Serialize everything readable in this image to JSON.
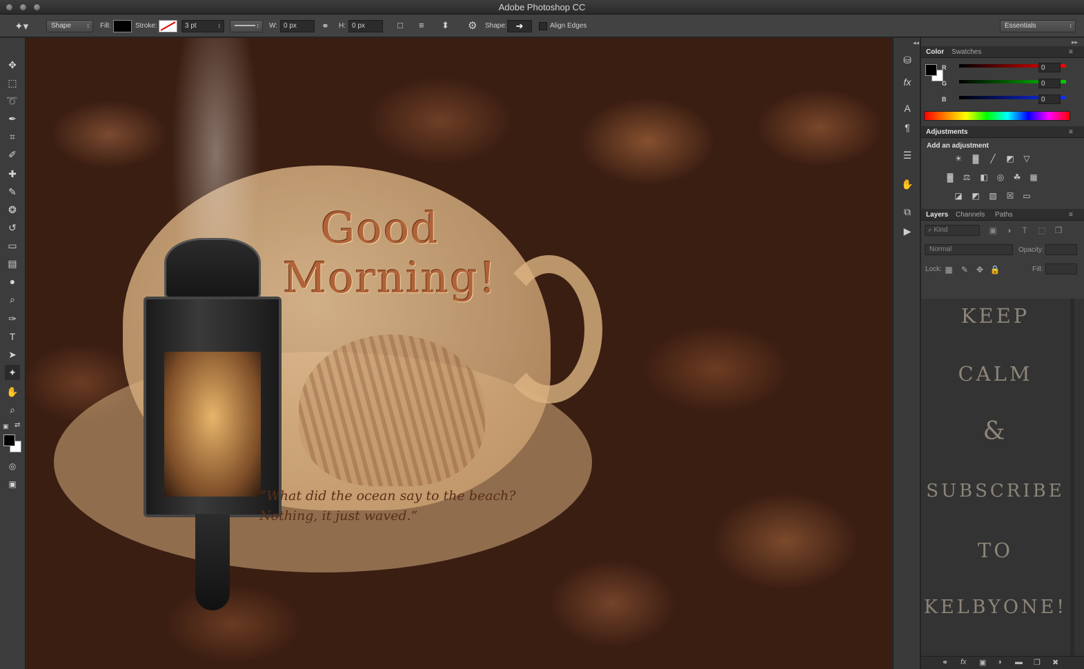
{
  "app": {
    "title": "Adobe Photoshop CC"
  },
  "options_bar": {
    "tool_mode": "Shape",
    "fill_label": "Fill:",
    "stroke_label": "Stroke:",
    "stroke_width": "3 pt",
    "width_label": "W:",
    "width_value": "0 px",
    "height_label": "H:",
    "height_value": "0 px",
    "shape_label": "Shape:",
    "align_edges_label": "Align Edges",
    "workspace": "Essentials"
  },
  "canvas": {
    "headline_line1": "Good",
    "headline_line2": "Morning!",
    "quote_line1": "“What did the ocean say to the beach?",
    "quote_line2": "Nothing, it just waved.”"
  },
  "color_panel": {
    "tab_color": "Color",
    "tab_swatches": "Swatches",
    "r_label": "R",
    "g_label": "G",
    "b_label": "B",
    "r_value": "0",
    "g_value": "0",
    "b_value": "0"
  },
  "adjustments_panel": {
    "tab": "Adjustments",
    "heading": "Add an adjustment"
  },
  "layers_panel": {
    "tab_layers": "Layers",
    "tab_channels": "Channels",
    "tab_paths": "Paths",
    "filter_kind": "Kind",
    "blend_mode": "Normal",
    "opacity_label": "Opacity:",
    "lock_label": "Lock:",
    "fill_label": "Fill:",
    "overlay_lines": [
      "KEEP",
      "CALM",
      "&",
      "SUBSCRIBE",
      "TO",
      "KELBYONE!"
    ]
  }
}
